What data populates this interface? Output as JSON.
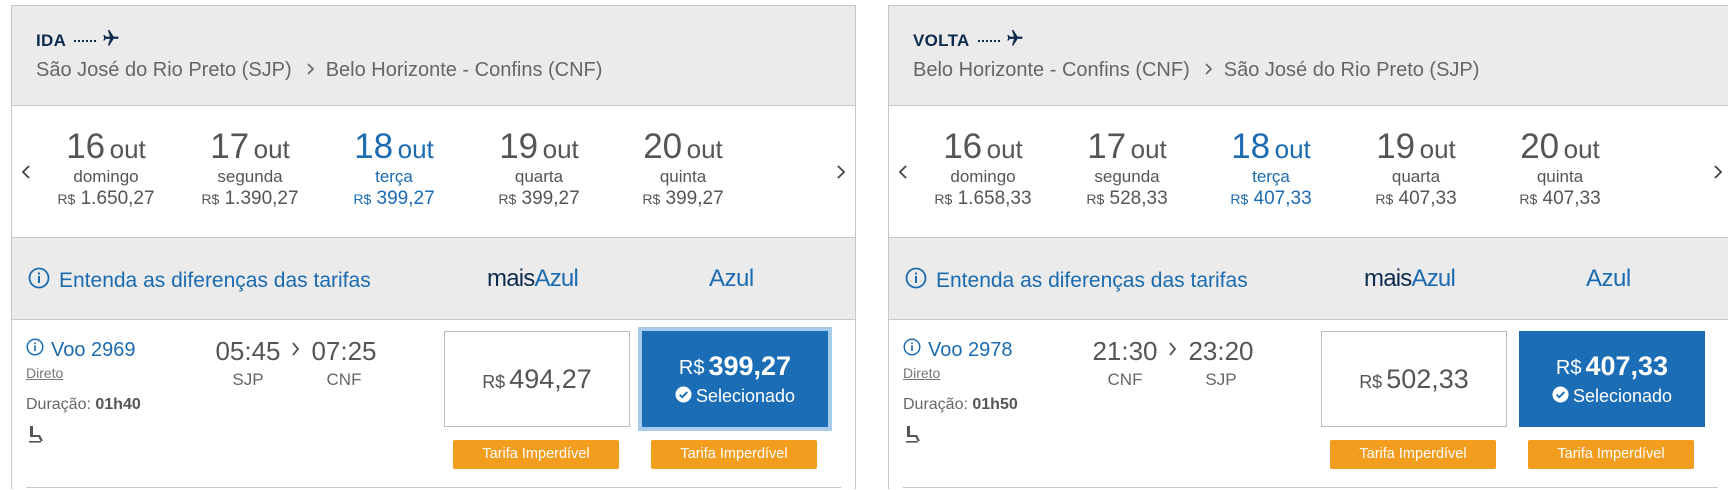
{
  "ida": {
    "direction_label": "IDA",
    "origin": "São José do Rio Preto (SJP)",
    "destination": "Belo Horizonte - Confins (CNF)",
    "dates": [
      {
        "day": "16",
        "month": "out",
        "weekday": "domingo",
        "currency": "R$",
        "price": "1.650,27",
        "selected": false
      },
      {
        "day": "17",
        "month": "out",
        "weekday": "segunda",
        "currency": "R$",
        "price": "1.390,27",
        "selected": false
      },
      {
        "day": "18",
        "month": "out",
        "weekday": "terça",
        "currency": "R$",
        "price": "399,27",
        "selected": true
      },
      {
        "day": "19",
        "month": "out",
        "weekday": "quarta",
        "currency": "R$",
        "price": "399,27",
        "selected": false
      },
      {
        "day": "20",
        "month": "out",
        "weekday": "quinta",
        "currency": "R$",
        "price": "399,27",
        "selected": false
      }
    ],
    "fare_link": "Entenda as diferenças das tarifas",
    "brand_mais_a": "mais",
    "brand_mais_b": "Azul",
    "brand_azul": "Azul",
    "flight": {
      "number": "Voo 2969",
      "type": "Direto",
      "duration_label": "Duração:",
      "duration": "01h40",
      "depart_time": "05:45",
      "arrive_time": "07:25",
      "depart_airport": "SJP",
      "arrive_airport": "CNF",
      "fare_other_currency": "R$",
      "fare_other": "494,27",
      "fare_selected_currency": "R$",
      "fare_selected": "399,27",
      "selected_label": "Selecionado",
      "badge1": "Tarifa Imperdível",
      "badge2": "Tarifa Imperdível"
    }
  },
  "volta": {
    "direction_label": "VOLTA",
    "origin": "Belo Horizonte - Confins (CNF)",
    "destination": "São José do Rio Preto (SJP)",
    "dates": [
      {
        "day": "16",
        "month": "out",
        "weekday": "domingo",
        "currency": "R$",
        "price": "1.658,33",
        "selected": false
      },
      {
        "day": "17",
        "month": "out",
        "weekday": "segunda",
        "currency": "R$",
        "price": "528,33",
        "selected": false
      },
      {
        "day": "18",
        "month": "out",
        "weekday": "terça",
        "currency": "R$",
        "price": "407,33",
        "selected": true
      },
      {
        "day": "19",
        "month": "out",
        "weekday": "quarta",
        "currency": "R$",
        "price": "407,33",
        "selected": false
      },
      {
        "day": "20",
        "month": "out",
        "weekday": "quinta",
        "currency": "R$",
        "price": "407,33",
        "selected": false
      }
    ],
    "fare_link": "Entenda as diferenças das tarifas",
    "brand_mais_a": "mais",
    "brand_mais_b": "Azul",
    "brand_azul": "Azul",
    "flight": {
      "number": "Voo 2978",
      "type": "Direto",
      "duration_label": "Duração:",
      "duration": "01h50",
      "depart_time": "21:30",
      "arrive_time": "23:20",
      "depart_airport": "CNF",
      "arrive_airport": "SJP",
      "fare_other_currency": "R$",
      "fare_other": "502,33",
      "fare_selected_currency": "R$",
      "fare_selected": "407,33",
      "selected_label": "Selecionado",
      "badge1": "Tarifa Imperdível",
      "badge2": "Tarifa Imperdível"
    }
  },
  "icons": {
    "plane": "plane-icon",
    "chevron_right": "chevron-right-icon",
    "chevron_left": "chevron-left-icon",
    "info": "info-icon",
    "check": "check-circle-icon",
    "seat": "seat-icon"
  },
  "colors": {
    "brand_blue": "#1a6bb0",
    "navy": "#0d2b4e",
    "selected_fare_bg": "#1b6db6",
    "badge_orange": "#f39d1f",
    "header_gray": "#ebebeb"
  }
}
